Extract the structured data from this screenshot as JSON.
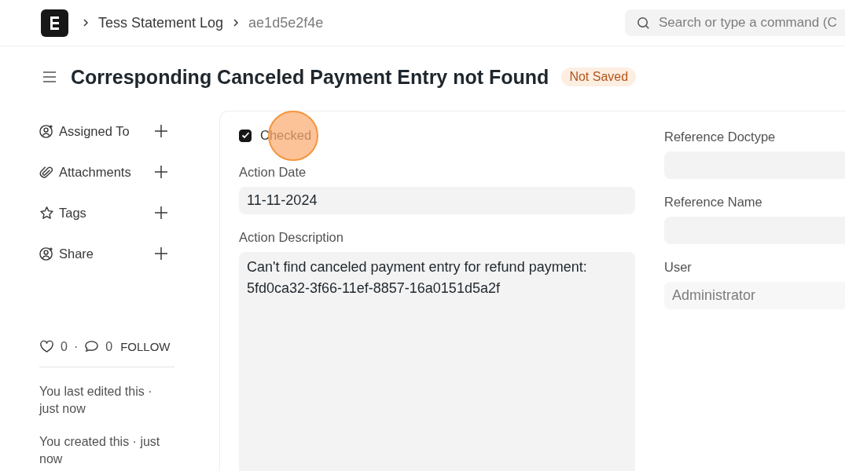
{
  "navbar": {
    "breadcrumbs": [
      {
        "label": "Tess Statement Log",
        "current": false
      },
      {
        "label": "ae1d5e2f4e",
        "current": true
      }
    ],
    "search": {
      "placeholder": "Search or type a command (C"
    }
  },
  "page": {
    "title": "Corresponding Canceled Payment Entry not Found",
    "status": "Not Saved"
  },
  "sidebar": {
    "actions": [
      {
        "label": "Assigned To",
        "kind": "assign"
      },
      {
        "label": "Attachments",
        "kind": "attach"
      },
      {
        "label": "Tags",
        "kind": "tag"
      },
      {
        "label": "Share",
        "kind": "share"
      }
    ],
    "likes": "0",
    "separator": "·",
    "comments": "0",
    "follow": "FOLLOW",
    "timeline": [
      "You last edited this · just now",
      "You created this · just now"
    ]
  },
  "form": {
    "checkbox": {
      "label": "Checked",
      "checked": true
    },
    "left_fields": [
      {
        "label": "Action Date",
        "value": "11-11-2024",
        "kind": "input",
        "read_only": false
      },
      {
        "label": "Action Description",
        "value": "Can't find canceled payment entry for refund payment:\n5fd0ca32-3f66-11ef-8857-16a0151d5a2f",
        "kind": "textarea",
        "read_only": false
      }
    ],
    "right_fields": [
      {
        "label": "Reference Doctype"
      },
      {
        "label": "Reference Name"
      },
      {
        "label": "User",
        "value": "Administrator",
        "read_only": true
      }
    ]
  }
}
